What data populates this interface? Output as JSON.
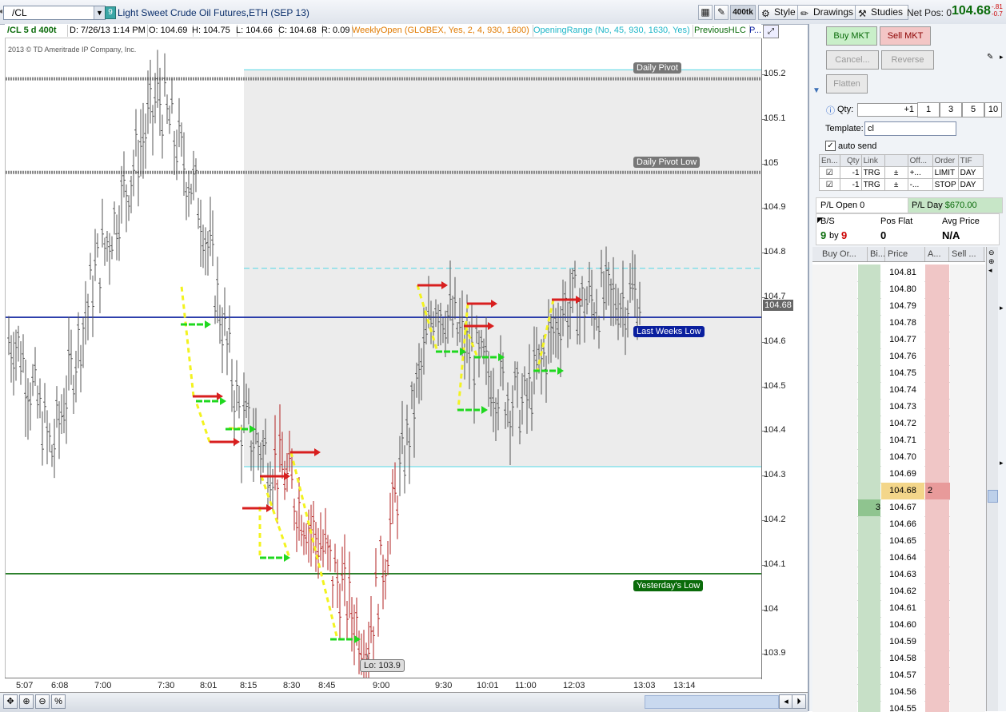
{
  "toolbar": {
    "symbol": "/CL",
    "link_number": "9",
    "description": "Light Sweet Crude Oil Futures,ETH (SEP 13)",
    "aggregation_badge": "400tk",
    "style_label": "Style",
    "drawings_label": "Drawings",
    "studies_label": "Studies",
    "net_pos_label": "Net Pos: 0",
    "net_price": "104.68",
    "net_chg_top": "-.81",
    "net_chg_bottom": "-0.7"
  },
  "study_header": {
    "symbol_period": "/CL 5 d 400t",
    "date": "D: 7/26/13 1:14 PM",
    "open": "O: 104.69",
    "high": "H: 104.75",
    "low": "L: 104.66",
    "close": "C: 104.68",
    "range": "R: 0.09",
    "weekly_open": "WeeklyOpen (GLOBEX, Yes, 2, 4, 930, 1600)",
    "opening_range": "OpeningRange (No, 45, 930, 1630, Yes)",
    "previous_hlc": "PreviousHLC",
    "more": "P..."
  },
  "copyright": "2013 © TD Ameritrade IP Company, Inc.",
  "price_axis": {
    "ticks": [
      "105.2",
      "105.1",
      "105",
      "104.9",
      "104.8",
      "104.7",
      "104.6",
      "104.5",
      "104.4",
      "104.3",
      "104.2",
      "104.1",
      "104",
      "103.9"
    ],
    "current": "104.68"
  },
  "time_axis": {
    "ticks": [
      "5:07",
      "6:08",
      "7:00",
      "7:30",
      "8:01",
      "8:15",
      "8:30",
      "8:45",
      "9:00",
      "9:30",
      "10:01",
      "11:00",
      "12:03",
      "13:03",
      "13:14"
    ]
  },
  "annotations": {
    "daily_pivot": "Daily Pivot",
    "daily_pivot_low": "Daily Pivot Low",
    "last_weeks_low": "Last Weeks Low",
    "yesterdays_low": "Yesterday's Low",
    "low_marker": "Lo: 103.9"
  },
  "colors": {
    "up_bar": "#555555",
    "down_bar": "#b22222",
    "pivot_line": "#888888",
    "last_weeks_low_line": "#0a1f9e",
    "yesterday_low_line": "#0a6b0a",
    "opening_range_fill": "#ececec",
    "opening_range_line": "#55d8e6",
    "buy_arrow": "#1fd81f",
    "sell_arrow": "#d81f1f",
    "connector": "#f3f31f"
  },
  "chart_data": {
    "type": "line",
    "title": "",
    "xlabel": "",
    "ylabel": "",
    "ylim": [
      103.85,
      105.27
    ],
    "x": [
      "5:07",
      "6:08",
      "7:00",
      "7:30",
      "8:01",
      "8:15",
      "8:30",
      "8:45",
      "9:00",
      "9:30",
      "10:01",
      "11:00",
      "12:03",
      "13:03"
    ],
    "series": [
      {
        "values": [
          104.6,
          104.35,
          104.75,
          105.15,
          104.9,
          104.42,
          104.3,
          104.15,
          103.92,
          104.7,
          104.55,
          104.45,
          104.68,
          104.7
        ]
      }
    ],
    "levels": [
      {
        "label": "Daily Pivot",
        "value": 105.19
      },
      {
        "label": "Daily Pivot Low",
        "value": 104.98
      },
      {
        "label": "Last Weeks Low",
        "value": 104.655
      },
      {
        "label": "Yesterday's Low",
        "value": 104.08
      }
    ],
    "opening_range": {
      "high": 105.21,
      "low": 104.32,
      "mid": 104.765
    },
    "low_marker": 103.9
  },
  "order_panel": {
    "buy_mkt": "Buy MKT",
    "sell_mkt": "Sell MKT",
    "cancel": "Cancel...",
    "reverse": "Reverse",
    "flatten": "Flatten",
    "qty_label": "Qty:",
    "qty_value": "+1",
    "qty_presets": [
      "1",
      "3",
      "5",
      "10"
    ],
    "template_label": "Template:",
    "template_value": "cl",
    "auto_send": "auto send",
    "table_headers": [
      "En...",
      "Qty",
      "Link",
      "",
      "Off...",
      "Order",
      "TIF"
    ],
    "rows": [
      {
        "qty": "-1",
        "link": "TRG",
        "off": "+...",
        "order": "LIMIT",
        "tif": "DAY"
      },
      {
        "qty": "-1",
        "link": "TRG",
        "off": "-...",
        "order": "STOP",
        "tif": "DAY"
      }
    ],
    "pl_open": "P/L Open 0",
    "pl_day_label": "P/L Day",
    "pl_day_value": "$670.00",
    "bs_label": "B/S",
    "bs_buy": "9",
    "bs_by": "by",
    "bs_sell": "9",
    "pos_label": "Pos Flat",
    "pos_value": "0",
    "avg_label": "Avg Price",
    "avg_value": "N/A"
  },
  "ladder": {
    "headers": [
      "Buy Or...",
      "Bi...",
      "Price",
      "A...",
      "Sell ..."
    ],
    "prices": [
      "104.81",
      "104.80",
      "104.79",
      "104.78",
      "104.77",
      "104.76",
      "104.75",
      "104.74",
      "104.73",
      "104.72",
      "104.71",
      "104.70",
      "104.69",
      "104.68",
      "104.67",
      "104.66",
      "104.65",
      "104.64",
      "104.63",
      "104.62",
      "104.61",
      "104.60",
      "104.59",
      "104.58",
      "104.57",
      "104.56",
      "104.55"
    ],
    "bid_size": "3",
    "ask_size": "2",
    "last_price": "104.68"
  }
}
